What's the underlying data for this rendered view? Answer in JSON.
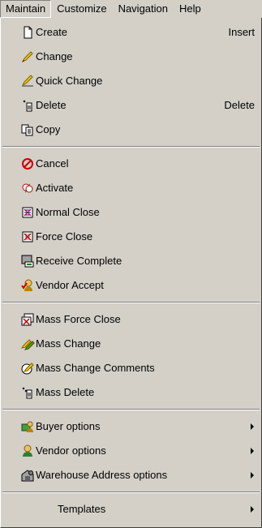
{
  "menubar": [
    "Maintain",
    "Customize",
    "Navigation",
    "Help"
  ],
  "menu": {
    "group1": [
      {
        "label": "Create",
        "shortcut": "Insert",
        "icon": "document-icon"
      },
      {
        "label": "Change",
        "shortcut": "",
        "icon": "pencil-icon"
      },
      {
        "label": "Quick Change",
        "shortcut": "",
        "icon": "pencil-ruler-icon"
      },
      {
        "label": "Delete",
        "shortcut": "Delete",
        "icon": "delete-icon"
      },
      {
        "label": "Copy",
        "shortcut": "",
        "icon": "copy-icon"
      }
    ],
    "group2": [
      {
        "label": "Cancel",
        "icon": "cancel-icon"
      },
      {
        "label": "Activate",
        "icon": "activate-icon"
      },
      {
        "label": "Normal Close",
        "icon": "normal-close-icon"
      },
      {
        "label": "Force Close",
        "icon": "force-close-icon"
      },
      {
        "label": "Receive Complete",
        "icon": "receive-complete-icon"
      },
      {
        "label": "Vendor Accept",
        "icon": "vendor-accept-icon"
      }
    ],
    "group3": [
      {
        "label": "Mass Force Close",
        "icon": "mass-force-close-icon"
      },
      {
        "label": "Mass Change",
        "icon": "mass-change-icon"
      },
      {
        "label": "Mass Change Comments",
        "icon": "mass-change-comments-icon"
      },
      {
        "label": "Mass Delete",
        "icon": "mass-delete-icon"
      }
    ],
    "group4": [
      {
        "label": "Buyer options",
        "icon": "buyer-icon"
      },
      {
        "label": "Vendor options",
        "icon": "vendor-icon"
      },
      {
        "label": "Warehouse Address options",
        "icon": "warehouse-icon"
      }
    ],
    "group5": [
      {
        "label": "Templates"
      }
    ]
  }
}
